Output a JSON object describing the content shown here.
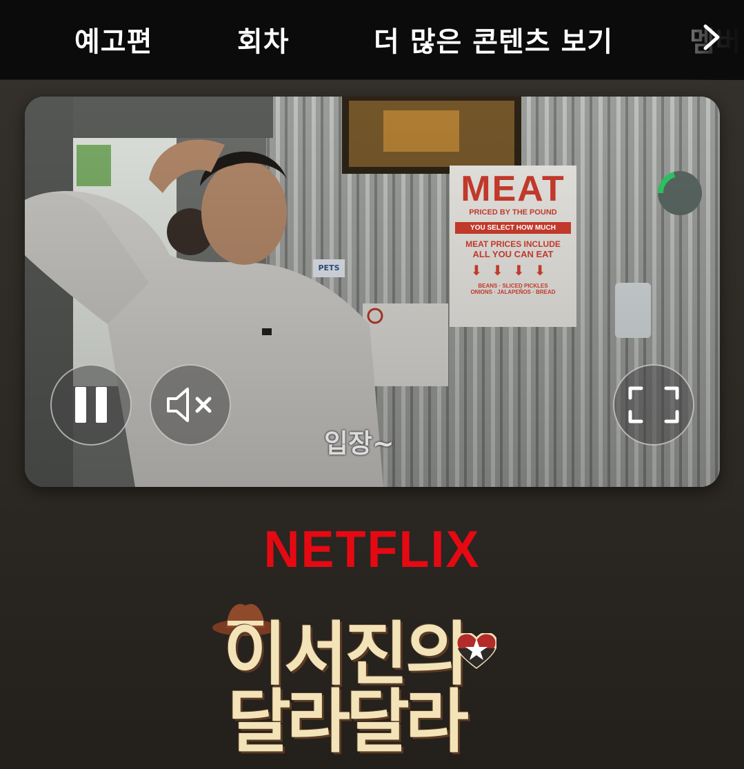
{
  "nav": {
    "tabs": [
      {
        "label": "예고편"
      },
      {
        "label": "회차"
      },
      {
        "label": "더 많은 콘텐츠 보기"
      },
      {
        "label": "멤버"
      }
    ],
    "next_icon": "chevron-right-icon"
  },
  "player": {
    "subtitle": "입장~",
    "scene_sign": {
      "title": "MEAT",
      "line1": "PRICED BY THE POUND",
      "line2": "YOU SELECT HOW MUCH",
      "line3": "MEAT PRICES INCLUDE",
      "line4": "ALL YOU CAN EAT",
      "line5": "BEANS · SLICED PICKLES",
      "line6": "ONIONS · JALAPEÑOS · BREAD",
      "small_sign": "PETS"
    },
    "controls": {
      "pause_icon": "pause-icon",
      "mute_icon": "speaker-muted-icon",
      "fullscreen_icon": "fullscreen-icon"
    }
  },
  "brand": {
    "logo_text": "NETFLIX",
    "logo_color": "#e50914",
    "show_title_line1": "이서진의",
    "show_title_line2": "달라달라",
    "title_color": "#f3e3b8"
  }
}
